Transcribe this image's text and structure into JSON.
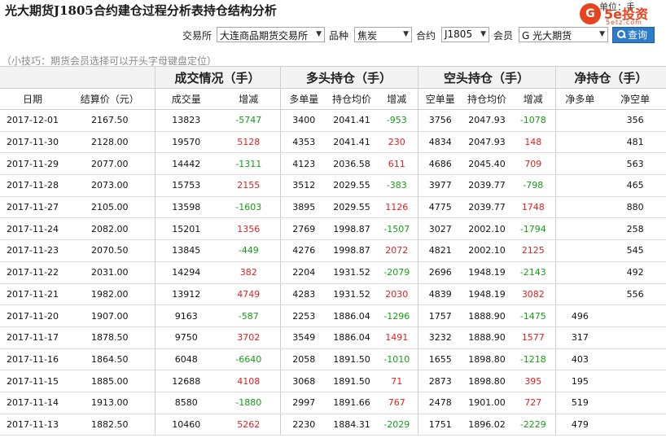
{
  "header": {
    "title": "光大期货J1805合约建仓过程分析表持仓结构分析",
    "unit_label": "单位：手",
    "logo_mark": "G",
    "logo_text": "5e投资",
    "logo_sub": "5etz.com"
  },
  "filters": {
    "exchange_label": "交易所",
    "exchange_value": "大连商品期货交易所",
    "product_label": "品种",
    "product_value": "焦炭",
    "contract_label": "合约",
    "contract_value": "J1805",
    "member_label": "会员",
    "member_value": "G 光大期货",
    "query_label": "查询"
  },
  "tip": "（小技巧：期货会员选择可以开头字母键盘定位）",
  "table": {
    "groups": [
      "成交情况（手）",
      "多头持仓（手）",
      "空头持仓（手）",
      "净持仓（手）"
    ],
    "columns": [
      "日期",
      "结算价（元）",
      "成交量",
      "增减",
      "多单量",
      "持仓均价",
      "增减",
      "空单量",
      "持仓均价",
      "增减",
      "净多单",
      "净空单"
    ],
    "rows": [
      {
        "date": "2017-12-01",
        "settle": "2167.50",
        "volume": "13823",
        "vol_chg": "-5747",
        "long": "3400",
        "long_avg": "2041.41",
        "long_chg": "-953",
        "short": "3756",
        "short_avg": "2047.93",
        "short_chg": "-1078",
        "net_long": "",
        "net_short": "356"
      },
      {
        "date": "2017-11-30",
        "settle": "2128.00",
        "volume": "19570",
        "vol_chg": "5128",
        "long": "4353",
        "long_avg": "2041.41",
        "long_chg": "230",
        "short": "4834",
        "short_avg": "2047.93",
        "short_chg": "148",
        "net_long": "",
        "net_short": "481"
      },
      {
        "date": "2017-11-29",
        "settle": "2077.00",
        "volume": "14442",
        "vol_chg": "-1311",
        "long": "4123",
        "long_avg": "2036.58",
        "long_chg": "611",
        "short": "4686",
        "short_avg": "2045.40",
        "short_chg": "709",
        "net_long": "",
        "net_short": "563"
      },
      {
        "date": "2017-11-28",
        "settle": "2073.00",
        "volume": "15753",
        "vol_chg": "2155",
        "long": "3512",
        "long_avg": "2029.55",
        "long_chg": "-383",
        "short": "3977",
        "short_avg": "2039.77",
        "short_chg": "-798",
        "net_long": "",
        "net_short": "465"
      },
      {
        "date": "2017-11-27",
        "settle": "2105.00",
        "volume": "13598",
        "vol_chg": "-1603",
        "long": "3895",
        "long_avg": "2029.55",
        "long_chg": "1126",
        "short": "4775",
        "short_avg": "2039.77",
        "short_chg": "1748",
        "net_long": "",
        "net_short": "880"
      },
      {
        "date": "2017-11-24",
        "settle": "2082.00",
        "volume": "15201",
        "vol_chg": "1356",
        "long": "2769",
        "long_avg": "1998.87",
        "long_chg": "-1507",
        "short": "3027",
        "short_avg": "2002.10",
        "short_chg": "-1794",
        "net_long": "",
        "net_short": "258"
      },
      {
        "date": "2017-11-23",
        "settle": "2070.50",
        "volume": "13845",
        "vol_chg": "-449",
        "long": "4276",
        "long_avg": "1998.87",
        "long_chg": "2072",
        "short": "4821",
        "short_avg": "2002.10",
        "short_chg": "2125",
        "net_long": "",
        "net_short": "545"
      },
      {
        "date": "2017-11-22",
        "settle": "2031.00",
        "volume": "14294",
        "vol_chg": "382",
        "long": "2204",
        "long_avg": "1931.52",
        "long_chg": "-2079",
        "short": "2696",
        "short_avg": "1948.19",
        "short_chg": "-2143",
        "net_long": "",
        "net_short": "492"
      },
      {
        "date": "2017-11-21",
        "settle": "1982.00",
        "volume": "13912",
        "vol_chg": "4749",
        "long": "4283",
        "long_avg": "1931.52",
        "long_chg": "2030",
        "short": "4839",
        "short_avg": "1948.19",
        "short_chg": "3082",
        "net_long": "",
        "net_short": "556"
      },
      {
        "date": "2017-11-20",
        "settle": "1907.00",
        "volume": "9163",
        "vol_chg": "-587",
        "long": "2253",
        "long_avg": "1886.04",
        "long_chg": "-1296",
        "short": "1757",
        "short_avg": "1888.90",
        "short_chg": "-1475",
        "net_long": "496",
        "net_short": ""
      },
      {
        "date": "2017-11-17",
        "settle": "1878.50",
        "volume": "9750",
        "vol_chg": "3702",
        "long": "3549",
        "long_avg": "1886.04",
        "long_chg": "1491",
        "short": "3232",
        "short_avg": "1888.90",
        "short_chg": "1577",
        "net_long": "317",
        "net_short": ""
      },
      {
        "date": "2017-11-16",
        "settle": "1864.50",
        "volume": "6048",
        "vol_chg": "-6640",
        "long": "2058",
        "long_avg": "1891.50",
        "long_chg": "-1010",
        "short": "1655",
        "short_avg": "1898.80",
        "short_chg": "-1218",
        "net_long": "403",
        "net_short": ""
      },
      {
        "date": "2017-11-15",
        "settle": "1885.00",
        "volume": "12688",
        "vol_chg": "4108",
        "long": "3068",
        "long_avg": "1891.50",
        "long_chg": "71",
        "short": "2873",
        "short_avg": "1898.80",
        "short_chg": "395",
        "net_long": "195",
        "net_short": ""
      },
      {
        "date": "2017-11-14",
        "settle": "1913.00",
        "volume": "8580",
        "vol_chg": "-1880",
        "long": "2997",
        "long_avg": "1891.66",
        "long_chg": "767",
        "short": "2478",
        "short_avg": "1901.00",
        "short_chg": "727",
        "net_long": "519",
        "net_short": ""
      },
      {
        "date": "2017-11-13",
        "settle": "1882.50",
        "volume": "10460",
        "vol_chg": "5262",
        "long": "2230",
        "long_avg": "1884.31",
        "long_chg": "-2029",
        "short": "1751",
        "short_avg": "1896.02",
        "short_chg": "-2229",
        "net_long": "479",
        "net_short": ""
      }
    ]
  }
}
